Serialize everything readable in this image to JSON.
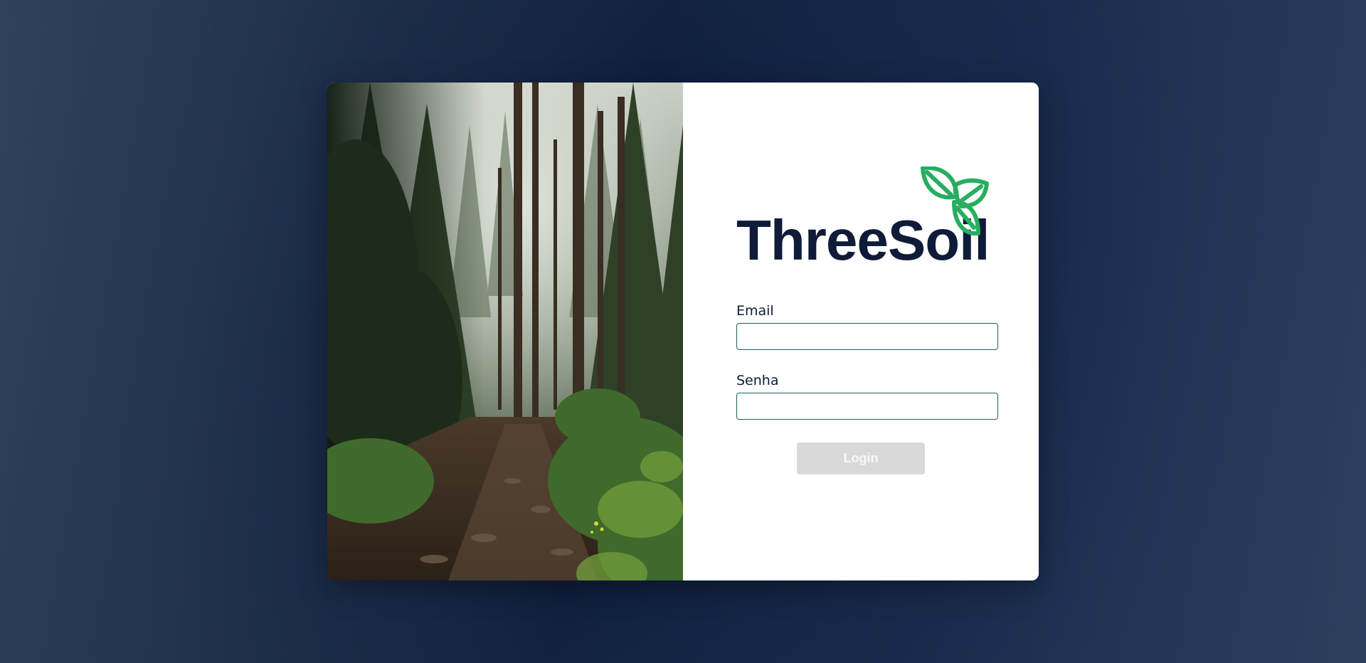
{
  "brand": {
    "name": "ThreeSoil",
    "logo_icon": "three-leaves-logo",
    "text_color": "#0f1b38",
    "leaf_color": "#27ae60"
  },
  "login_form": {
    "email_label": "Email",
    "email_value": "",
    "password_label": "Senha",
    "password_value": "",
    "submit_label": "Login",
    "input_border_color": "#1f5f63",
    "button_disabled_color": "#d9d9d9"
  },
  "hero_image": {
    "subject": "forest-path-photo"
  }
}
